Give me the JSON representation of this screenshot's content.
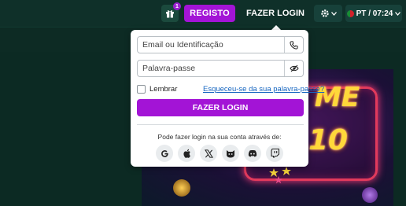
{
  "header": {
    "gift_badge": "1",
    "register_label": "REGISTO",
    "login_label": "FAZER LOGIN",
    "language_label": "PT / 07:24"
  },
  "login_popover": {
    "email_placeholder": "Email ou Identificação",
    "password_placeholder": "Palavra-passe",
    "remember_label": "Lembrar",
    "forgot_link": "Esqueceu-se da sua palavra-passe?",
    "submit_label": "FAZER LOGIN",
    "social_text": "Pode fazer login na sua conta através de:",
    "social_icons": [
      "google-icon",
      "apple-icon",
      "x-icon",
      "steam-icon",
      "discord-icon",
      "twitch-icon"
    ]
  },
  "colors": {
    "accent": "#a314d6",
    "topbar": "#0f3029",
    "link": "#1565c0"
  }
}
